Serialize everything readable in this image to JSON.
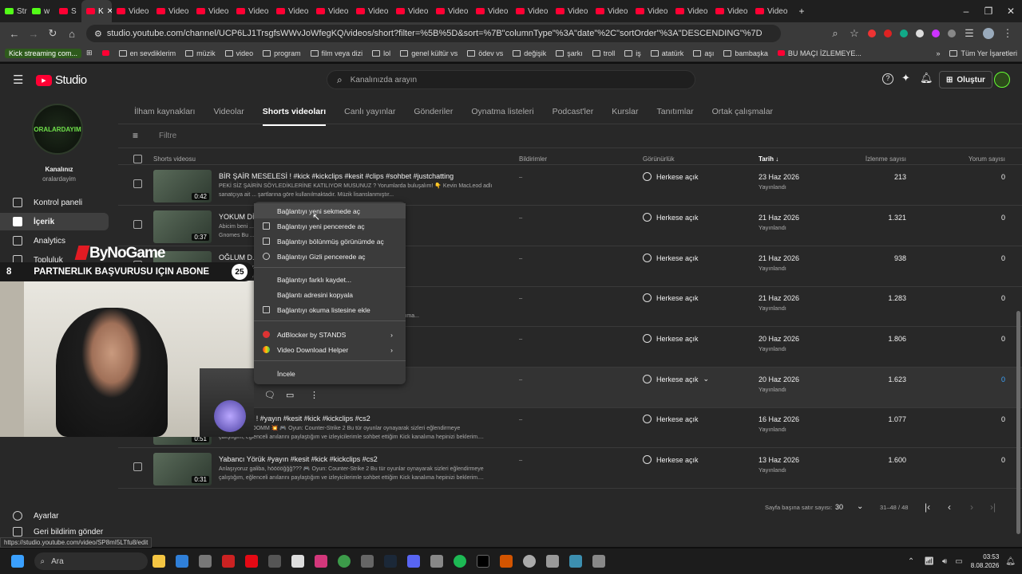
{
  "browser": {
    "tabs": [
      {
        "label": "Strea",
        "icon": "kick"
      },
      {
        "label": "w",
        "icon": "kick"
      },
      {
        "label": "S",
        "icon": "yt"
      },
      {
        "label": "K",
        "icon": "yt",
        "active": true
      },
      {
        "label": "Video",
        "icon": "yt"
      },
      {
        "label": "Video",
        "icon": "yt"
      },
      {
        "label": "Video",
        "icon": "yt"
      },
      {
        "label": "Video",
        "icon": "yt"
      },
      {
        "label": "Video",
        "icon": "yt"
      },
      {
        "label": "Video",
        "icon": "yt"
      },
      {
        "label": "Video",
        "icon": "yt"
      },
      {
        "label": "Video",
        "icon": "yt"
      },
      {
        "label": "Video",
        "icon": "yt"
      },
      {
        "label": "Video",
        "icon": "yt"
      },
      {
        "label": "Video",
        "icon": "yt"
      },
      {
        "label": "Video",
        "icon": "yt"
      },
      {
        "label": "Video",
        "icon": "yt"
      },
      {
        "label": "Video",
        "icon": "yt"
      },
      {
        "label": "Video",
        "icon": "yt"
      },
      {
        "label": "Video",
        "icon": "yt"
      },
      {
        "label": "Video",
        "icon": "yt"
      }
    ],
    "url": "studio.youtube.com/channel/UCP6LJ1TrsgfsWWvJoWfegKQ/videos/short?filter=%5B%5D&sort=%7B\"columnType\"%3A\"date\"%2C\"sortOrder\"%3A\"DESCENDING\"%7D",
    "bookmarks": [
      "Kick streaming com...",
      "en sevdiklerim",
      "müzik",
      "video",
      "program",
      "film veya dizi",
      "lol",
      "genel kültür vs",
      "ödev vs",
      "değişik",
      "şarkı",
      "troll",
      "iş",
      "atatürk",
      "aşı",
      "bambaşka",
      "BU MAÇI İZLEMEYE..."
    ],
    "bookmarks_right": "Tüm Yer İşaretleri",
    "status_url": "https://studio.youtube.com/video/SP8mI5LTfu8/edit"
  },
  "header": {
    "logo": "Studio",
    "search_placeholder": "Kanalınızda arayın",
    "create_label": "Oluştur"
  },
  "channel": {
    "section_label": "Kanalınız",
    "name": "oralardayim",
    "avatar_text": "ORALARDAYIM"
  },
  "sidebar": {
    "items": [
      {
        "label": "Kontrol paneli"
      },
      {
        "label": "İçerik"
      },
      {
        "label": "Analytics"
      },
      {
        "label": "Topluluk"
      }
    ],
    "settings": "Ayarlar",
    "feedback": "Geri bildirim gönder"
  },
  "tabs": [
    "İlham kaynakları",
    "Videolar",
    "Shorts videoları",
    "Canlı yayınlar",
    "Gönderiler",
    "Oynatma listeleri",
    "Podcast'ler",
    "Kurslar",
    "Tanıtımlar",
    "Ortak çalışmalar"
  ],
  "filter_label": "Filtre",
  "columns": {
    "video": "Shorts videosu",
    "notifications": "Bildirimler",
    "visibility": "Görünürlük",
    "date": "Tarih",
    "views": "İzlenme sayısı",
    "comments": "Yorum sayısı"
  },
  "rows": [
    {
      "title": "BİR ŞAİR MESELESİ ! #kick #kickclips #kesit #clips #sohbet #justchatting",
      "desc1": "PEKİ SİZ ŞAİRİN SÖYLEDİKLERİNE KATILIYOR MUSUNUZ ? Yorumlarda buluşalım! 👇 Kevin MacLeod adlı",
      "desc2": "sanatçıya ait ... şartlarına göre kullanılmaktadır. Müzik lisanslanmıştır...",
      "dur": "0:42",
      "notif": "–",
      "vis": "Herkese açık",
      "date": "23 Haz 2026",
      "status": "Yayınlandı",
      "views": "213",
      "comments": "0"
    },
    {
      "title": "YOKUM Dİ ... kickclips #gnomes #burglingno...",
      "desc1": "Abicim beni ... lamlarda buluşalım! 👇 🎮 Oyun: Burglin'",
      "desc2": "Gnomes Bu ... anılarını paylaştığım ve izleyicilerim...",
      "dur": "0:37",
      "notif": "–",
      "vis": "Herkese açık",
      "date": "21 Haz 2026",
      "status": "Yayınlandı",
      "views": "1.321",
      "comments": "0"
    },
    {
      "title": "OĞLUM D...",
      "desc1": "Sanat Psi... nda neler düşünüyorsunuz?",
      "desc2": "... izleyicilerimle sizleri eğlendirmeye çalıştığ...",
      "dur": "",
      "notif": "–",
      "vis": "Herkese açık",
      "date": "21 Haz 2026",
      "status": "Yayınlandı",
      "views": "938",
      "comments": "0"
    },
    {
      "title": "",
      "desc1": "... Counter-Strike 2 Bu tür oyunlar oynayarak",
      "desc2": "... sizleri eğlendirmeye çalıştığım ve izleyicilerimle sohbet ettiğim Kick kanalıma...",
      "dur": "",
      "notif": "–",
      "vis": "Herkese açık",
      "date": "21 Haz 2026",
      "status": "Yayınlandı",
      "views": "1.283",
      "comments": "0"
    },
    {
      "title": "... cs2",
      "desc1": "... 🎮 Oyun: Counter-Strike 2 Bu tür",
      "desc2": "... ve izleyicilerimle sohbet ettiğim Kick kanalıma hepinizi bekl...",
      "dur": "",
      "notif": "–",
      "vis": "Herkese açık",
      "date": "20 Haz 2026",
      "status": "Yayınlandı",
      "views": "1.806",
      "comments": "0"
    },
    {
      "title": "... #kick #kickclips #gnomes #yayın #kesit #shorts",
      "desc1": "",
      "desc2": "",
      "dur": "",
      "notif": "–",
      "vis": "Herkese açık",
      "date": "20 Haz 2026",
      "status": "Yayınlandı",
      "views": "1.623",
      "comments": "0",
      "hover": true
    },
    {
      "title": "... İYE SAY ! #yayın #kesit #kick #kickclips #cs2",
      "desc1": "Şaka şaka, BOOMM 💥 🎮 Oyun: Counter-Strike 2 Bu tür oyunlar oynayarak sizleri eğlendirmeye",
      "desc2": "çalıştığım, eğlenceli anılarını paylaştığım ve izleyicilerimle sohbet ettiğim Kick kanalıma hepinizi beklerim....",
      "dur": "0:51",
      "notif": "–",
      "vis": "Herkese açık",
      "date": "16 Haz 2026",
      "status": "Yayınlandı",
      "views": "1.077",
      "comments": "0"
    },
    {
      "title": "Yabancı Yörük #yayın #kesit #kick #kickclips #cs2",
      "desc1": "Anlaşıyoruz galiba, hööööğğğ??? 🎮 Oyun: Counter-Strike 2 Bu tür oyunlar oynayarak sizleri eğlendirmeye",
      "desc2": "çalıştığım, eğlenceli anılarını paylaştığım ve izleyicilerimle sohbet ettiğim Kick kanalıma hepinizi beklerim....",
      "dur": "0:31",
      "notif": "–",
      "vis": "Herkese açık",
      "date": "13 Haz 2026",
      "status": "Yayınlandı",
      "views": "1.600",
      "comments": "0"
    }
  ],
  "pagination": {
    "rows_label": "Sayfa başına satır sayısı:",
    "rows_value": "30",
    "range": "31–48 / 48"
  },
  "context_menu": {
    "items": [
      "Bağlantıyı yeni sekmede aç",
      "Bağlantıyı yeni pencerede aç",
      "Bağlantıyı bölünmüş görünümde aç",
      "Bağlantıyı Gizli pencerede aç",
      "Bağlantıyı farklı kaydet...",
      "Bağlantı adresini kopyala",
      "Bağlantıyı okuma listesine ekle",
      "AdBlocker by STANDS",
      "Video Download Helper",
      "İncele"
    ]
  },
  "overlay": {
    "brand": "ByNoGame",
    "banner_left": "8",
    "banner_text": "PARTNERLIK BAŞVURUSU IÇIN ABONE",
    "banner_right": "25"
  },
  "taskbar": {
    "search": "Ara",
    "time": "03:53",
    "date": "8.08.2026"
  }
}
